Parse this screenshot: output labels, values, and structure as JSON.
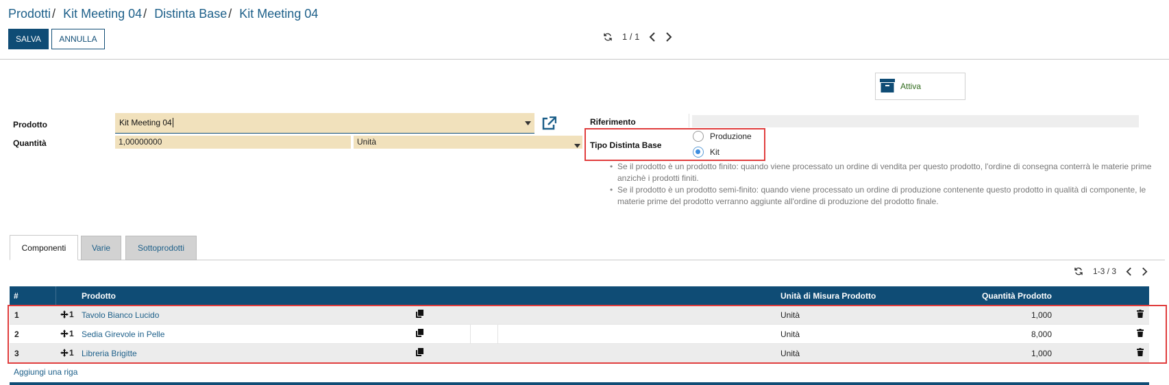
{
  "breadcrumb": [
    "Prodotti",
    "Kit Meeting 04",
    "Distinta Base",
    "Kit Meeting 04"
  ],
  "toolbar": {
    "save": "SALVA",
    "discard": "ANNULLA"
  },
  "pager": {
    "value": "1 / 1"
  },
  "smart_button": {
    "label": "Attiva"
  },
  "form": {
    "product_label": "Prodotto",
    "product_value": "Kit Meeting 04",
    "quantity_label": "Quantità",
    "quantity_value": "1,00000000",
    "uom_value": "Unità",
    "reference_label": "Riferimento",
    "reference_value": "",
    "bom_type_label": "Tipo Distinta Base",
    "bom_type_options": [
      "Produzione",
      "Kit"
    ],
    "bom_type_selected": "Kit",
    "help": [
      "Se il prodotto è un prodotto finito: quando viene processato un ordine di vendita per questo prodotto, l'ordine di consegna conterrà le materie prime anzichè i prodotti finiti.",
      "Se il prodotto è un prodotto semi-finito: quando viene processato un ordine di produzione contenente questo prodotto in qualità di componente, le materie prime del prodotto verranno aggiunte all'ordine di produzione del prodotto finale."
    ]
  },
  "tabs": [
    "Componenti",
    "Varie",
    "Sottoprodotti"
  ],
  "list_pager": {
    "value": "1-3 / 3"
  },
  "table": {
    "columns": [
      "#",
      "Prodotto",
      "Quantità Prodotto",
      "Unità di Misura Prodotto"
    ],
    "rows": [
      {
        "seq": "1",
        "handle": "1",
        "product": "Tavolo Bianco Lucido",
        "qty": "1,000",
        "uom": "Unità"
      },
      {
        "seq": "2",
        "handle": "1",
        "product": "Sedia Girevole in Pelle",
        "qty": "8,000",
        "uom": "Unità"
      },
      {
        "seq": "3",
        "handle": "1",
        "product": "Libreria Brigitte",
        "qty": "1,000",
        "uom": "Unità"
      }
    ],
    "add_line": "Aggiungi una riga"
  },
  "colors": {
    "primary": "#0f4c75",
    "link": "#1c5f89",
    "required_bg": "#f1e1bc",
    "highlight": "#e03c3c",
    "active_green": "#2f6a1b"
  },
  "icons": [
    "refresh-icon",
    "chevron-left-icon",
    "chevron-right-icon",
    "archive-icon",
    "external-link-icon",
    "caret-down-icon",
    "move-handle-icon",
    "copy-icon",
    "trash-icon"
  ]
}
